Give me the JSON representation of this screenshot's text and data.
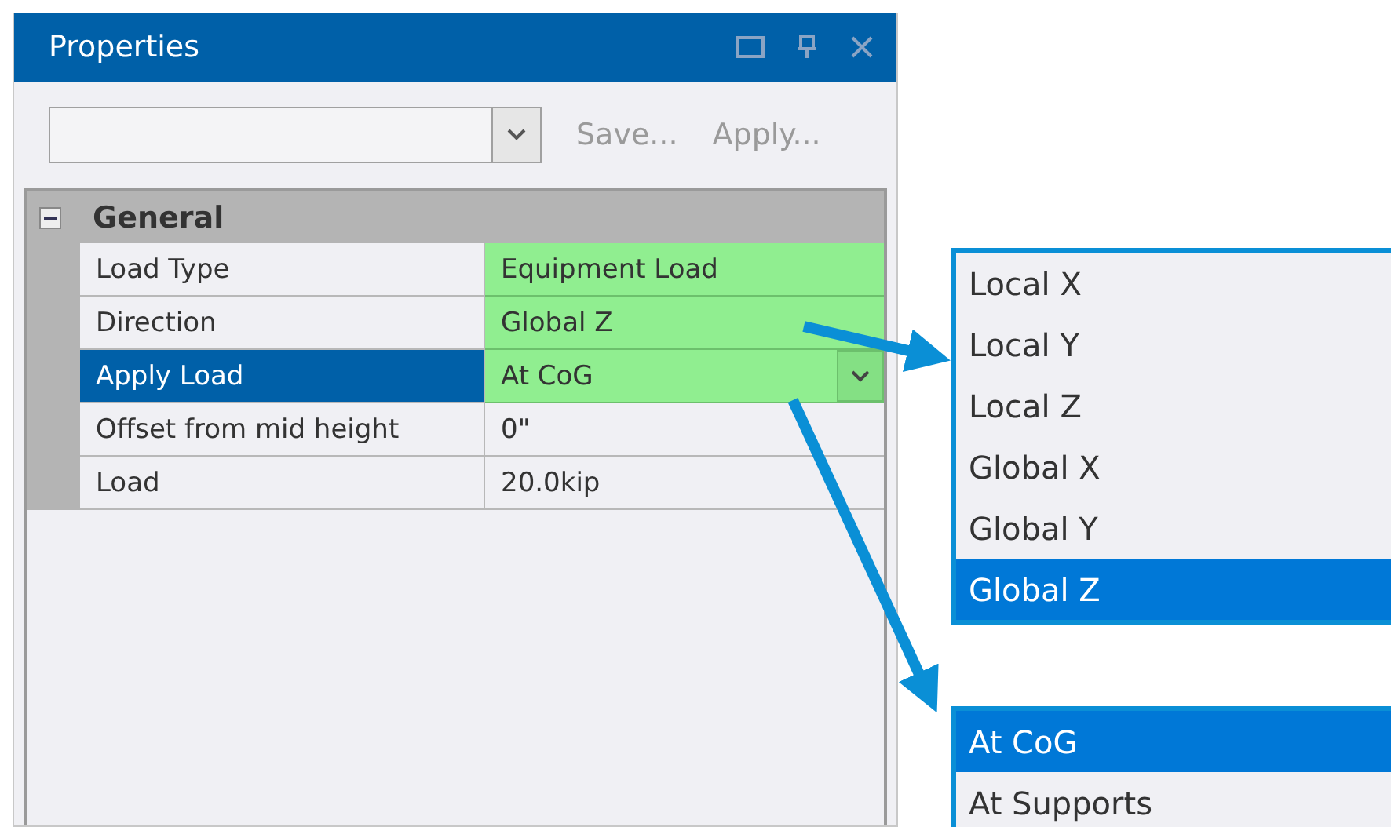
{
  "window": {
    "title": "Properties"
  },
  "toolbar": {
    "buttons": [
      {
        "label": "Save...",
        "disabled": true
      },
      {
        "label": "Apply...",
        "disabled": true
      }
    ]
  },
  "group": {
    "label": "General",
    "expanded": true,
    "rows": [
      {
        "name": "Load Type",
        "value": "Equipment Load",
        "selected": false,
        "highlighted": true,
        "dropdown": false
      },
      {
        "name": "Direction",
        "value": "Global Z",
        "selected": false,
        "highlighted": true,
        "dropdown": false
      },
      {
        "name": "Apply Load",
        "value": "At CoG",
        "selected": true,
        "highlighted": true,
        "dropdown": true
      },
      {
        "name": "Offset from mid height",
        "value": "0\"",
        "selected": false,
        "highlighted": false,
        "dropdown": false
      },
      {
        "name": "Load",
        "value": "20.0kip",
        "selected": false,
        "highlighted": false,
        "dropdown": false
      }
    ]
  },
  "popups": [
    {
      "items": [
        {
          "label": "Local X",
          "selected": false
        },
        {
          "label": "Local Y",
          "selected": false
        },
        {
          "label": "Local Z",
          "selected": false
        },
        {
          "label": "Global X",
          "selected": false
        },
        {
          "label": "Global Y",
          "selected": false
        },
        {
          "label": "Global Z",
          "selected": true
        }
      ]
    },
    {
      "items": [
        {
          "label": "At CoG",
          "selected": true
        },
        {
          "label": "At Supports",
          "selected": false
        }
      ]
    }
  ]
}
